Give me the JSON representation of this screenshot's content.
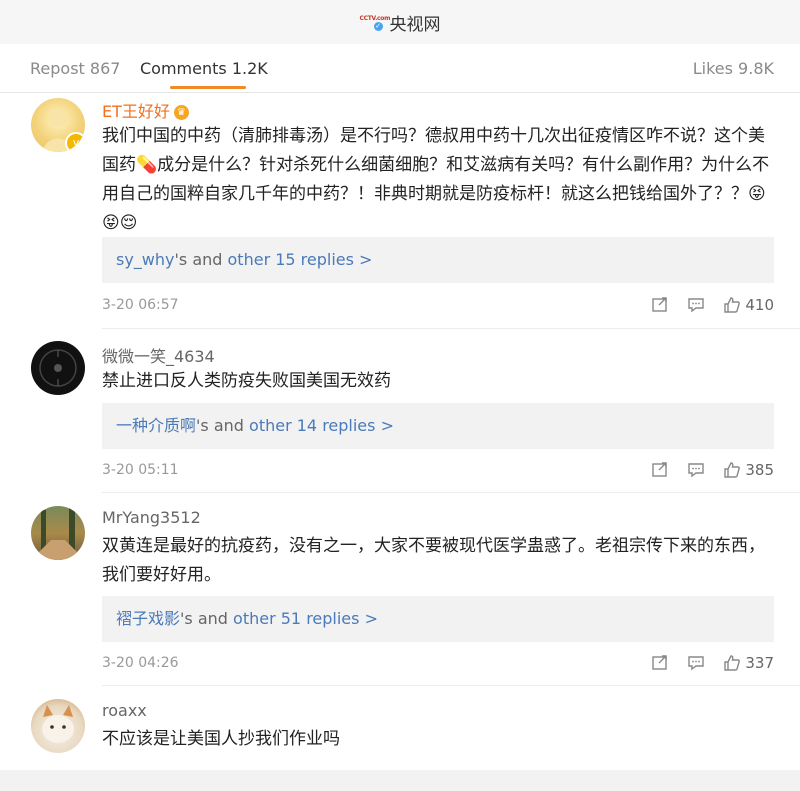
{
  "header": {
    "title": "央视网",
    "logo_text": "CCTV.com"
  },
  "tabs": {
    "repost": "Repost 867",
    "comments": "Comments 1.2K",
    "likes": "Likes 9.8K"
  },
  "comments": [
    {
      "username": "ET王好好",
      "text": "我们中国的中药（清肺排毒汤）是不行吗？德叔用中药十几次出征疫情区咋不说？这个美国药💊成分是什么？针对杀死什么细菌细胞？和艾滋病有关吗？有什么副作用？为什么不用自己的国粹自家几千年的中药？！非典时期就是防疫标杆！就这么把钱给国外了？？😝😝😌",
      "reply_user": "sy_why",
      "reply_mid": "'s and ",
      "reply_more": "other 15 replies >",
      "time": "3-20 06:57",
      "likes": "410"
    },
    {
      "username": "微微一笑_4634",
      "text": "禁止进口反人类防疫失败国美国无效药",
      "reply_user": "一种介质啊",
      "reply_mid": "'s and ",
      "reply_more": "other 14 replies >",
      "time": "3-20 05:11",
      "likes": "385"
    },
    {
      "username": "MrYang3512",
      "text": "双黄连是最好的抗疫药，没有之一，大家不要被现代医学蛊惑了。老祖宗传下来的东西，我们要好好用。",
      "reply_user": "褶子戏影",
      "reply_mid": "'s and ",
      "reply_more": "other 51 replies >",
      "time": "3-20 04:26",
      "likes": "337"
    },
    {
      "username": "roaxx",
      "text": "不应该是让美国人抄我们作业吗"
    }
  ]
}
